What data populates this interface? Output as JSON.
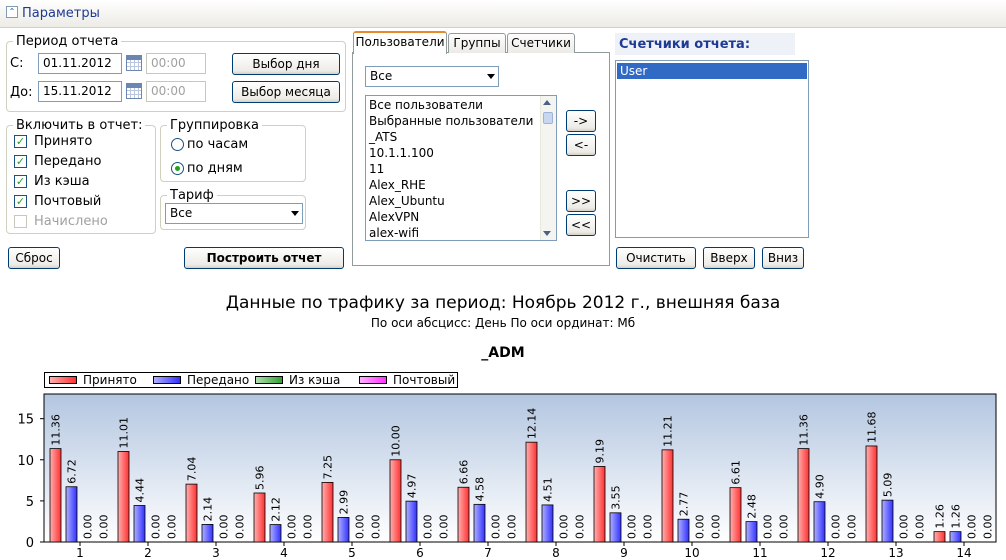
{
  "window": {
    "title": "Параметры"
  },
  "period": {
    "legend": "Период отчета",
    "from_label": "С:",
    "from_date": "01.11.2012",
    "from_time": "00:00",
    "to_label": "До:",
    "to_date": "15.11.2012",
    "to_time": "00:00",
    "day_button": "Выбор дня",
    "month_button": "Выбор месяца"
  },
  "include": {
    "legend": "Включить в отчет:",
    "items": [
      {
        "label": "Принято",
        "checked": true,
        "enabled": true
      },
      {
        "label": "Передано",
        "checked": true,
        "enabled": true
      },
      {
        "label": "Из кэша",
        "checked": true,
        "enabled": true
      },
      {
        "label": "Почтовый",
        "checked": true,
        "enabled": true
      },
      {
        "label": "Начислено",
        "checked": false,
        "enabled": false
      }
    ]
  },
  "grouping": {
    "legend": "Группировка",
    "options": [
      {
        "label": "по часам",
        "selected": false
      },
      {
        "label": "по дням",
        "selected": true
      }
    ]
  },
  "tariff": {
    "legend": "Тариф",
    "value": "Все"
  },
  "buttons": {
    "reset": "Сброс",
    "build": "Построить отчет",
    "clear": "Очистить",
    "up": "Вверх",
    "down": "Вниз"
  },
  "tabs": [
    "Пользователи",
    "Группы",
    "Счетчики"
  ],
  "user_filter": {
    "value": "Все"
  },
  "user_list": [
    "Все пользователи",
    "Выбранные пользователи",
    "_ATS",
    "10.1.1.100",
    "11",
    "Alex_RHE",
    "Alex_Ubuntu",
    "AlexVPN",
    "alex-wifi"
  ],
  "move_buttons": {
    "add": "->",
    "remove": "<-",
    "add_all": ">>",
    "remove_all": "<<"
  },
  "report_counters": {
    "title": "Счетчики отчета:",
    "items": [
      "User"
    ]
  },
  "chart_header": {
    "title": "Данные по трафику за период: Ноябрь 2012 г., внешняя база",
    "subtitle": "По оси абсцисс: День  По оси ординат: Мб",
    "name": "_ADM"
  },
  "colors": {
    "received": "#ff3030",
    "sent": "#3030ff",
    "cache": "#30a030",
    "mail": "#ff30ff",
    "plot_top": "#b3c6e0",
    "plot_bottom": "#ffffff"
  },
  "chart_data": {
    "type": "bar",
    "categories": [
      "1",
      "2",
      "3",
      "4",
      "5",
      "6",
      "7",
      "8",
      "9",
      "10",
      "11",
      "12",
      "13",
      "14"
    ],
    "series": [
      {
        "name": "Принято",
        "values": [
          11.36,
          11.01,
          7.04,
          5.96,
          7.25,
          10.0,
          6.66,
          12.14,
          9.19,
          11.21,
          6.61,
          11.36,
          11.68,
          1.26
        ]
      },
      {
        "name": "Передано",
        "values": [
          6.72,
          4.44,
          2.14,
          2.12,
          2.99,
          4.97,
          4.58,
          4.51,
          3.55,
          2.77,
          2.48,
          4.9,
          5.09,
          1.26
        ]
      },
      {
        "name": "Из кэша",
        "values": [
          0,
          0,
          0,
          0,
          0,
          0,
          0,
          0,
          0,
          0,
          0,
          0,
          0,
          0
        ]
      },
      {
        "name": "Почтовый",
        "values": [
          0,
          0,
          0,
          0,
          0,
          0,
          0,
          0,
          0,
          0,
          0,
          0,
          0,
          0
        ]
      }
    ],
    "yticks": [
      "0",
      "5",
      "10",
      "15"
    ],
    "ylim": [
      0,
      18
    ],
    "legend_position": "top-left"
  }
}
